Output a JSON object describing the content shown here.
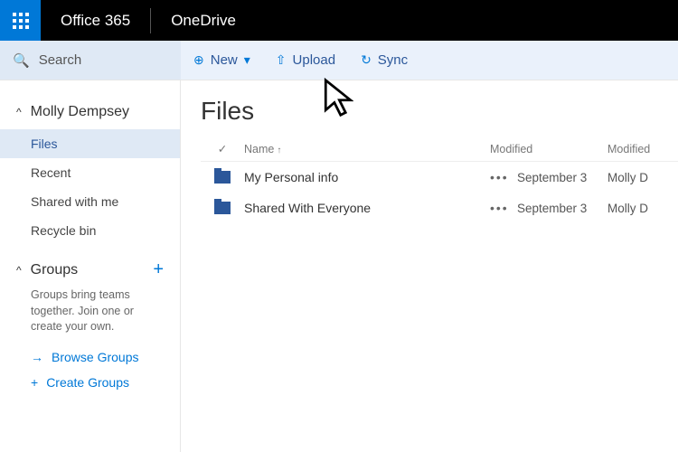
{
  "header": {
    "suite": "Office 365",
    "app": "OneDrive"
  },
  "search": {
    "placeholder": "Search"
  },
  "toolbar": {
    "new_label": "New",
    "upload_label": "Upload",
    "sync_label": "Sync"
  },
  "sidebar": {
    "user": "Molly Dempsey",
    "nav": {
      "files": "Files",
      "recent": "Recent",
      "shared": "Shared with me",
      "recycle": "Recycle bin"
    },
    "groups": {
      "title": "Groups",
      "description": "Groups bring teams together. Join one or create your own.",
      "browse": "Browse Groups",
      "create": "Create Groups"
    }
  },
  "main": {
    "title": "Files",
    "columns": {
      "name": "Name",
      "modified": "Modified",
      "modified_by": "Modified"
    },
    "rows": [
      {
        "name": "My Personal info",
        "modified": "September 3",
        "by": "Molly D"
      },
      {
        "name": "Shared With Everyone",
        "modified": "September 3",
        "by": "Molly D"
      }
    ]
  }
}
